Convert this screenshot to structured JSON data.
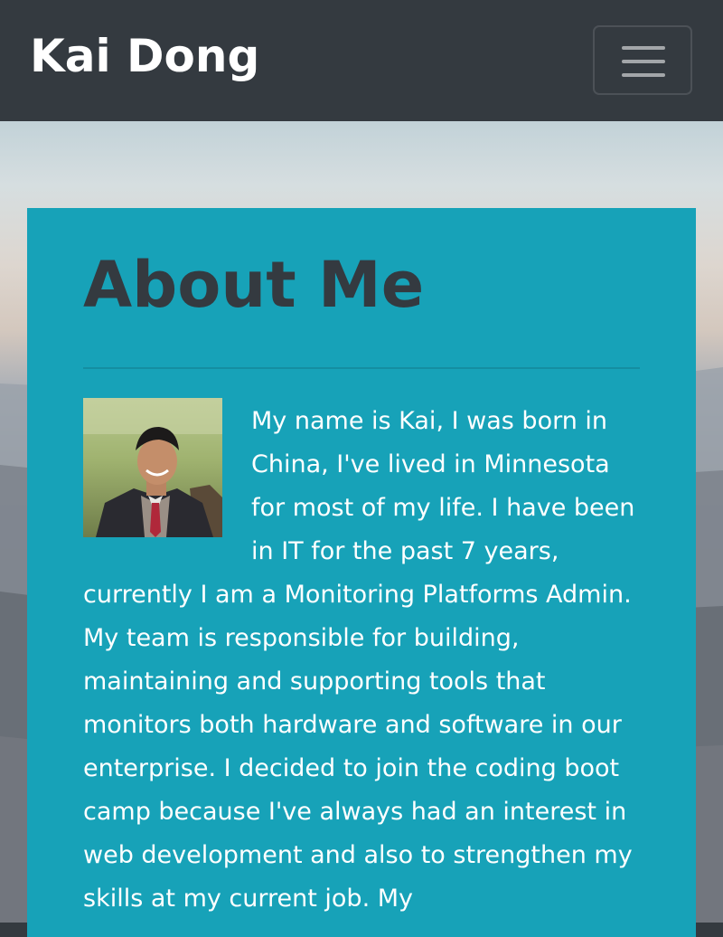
{
  "navbar": {
    "brand": "Kai Dong",
    "toggler_icon": "hamburger-icon"
  },
  "about": {
    "title": "About Me",
    "photo_icon": "profile-photo",
    "bio": "My name is Kai, I was born in China, I've lived in Minnesota for most of my life. I have been in IT for the past 7 years, currently I am a Monitoring Platforms Admin. My team is responsible for building, maintaining and supporting tools that monitors both hardware and software in our enterprise. I decided to join the coding boot camp because I've always had an interest in web development and also to strengthen my skills at my current job. My"
  },
  "colors": {
    "navbar_bg": "#343a40",
    "card_bg": "#17a2b8",
    "title_text": "#343a40",
    "body_text": "#ffffff"
  }
}
